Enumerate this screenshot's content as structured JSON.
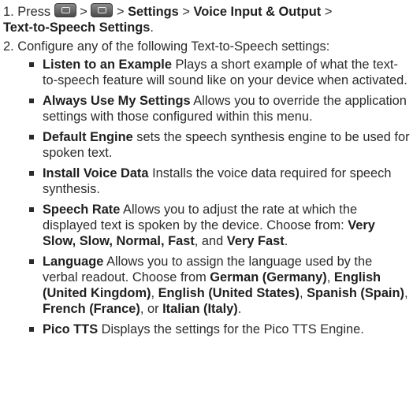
{
  "step1": {
    "number": "1.",
    "press": "Press",
    "sep": ">",
    "key1_icon": "menu-key-icon",
    "key2_icon": "menu-key-icon",
    "path1": "Settings",
    "path2": "Voice Input & Output",
    "path3": "Text-to-Speech Settings",
    "end": "."
  },
  "step2": {
    "number": "2.",
    "text": "Configure any of the following Text-to-Speech settings:"
  },
  "items": [
    {
      "title": "Listen to an Example",
      "desc": " Plays a short example of what the text-to-speech feature will sound like on your device when activated."
    },
    {
      "title": "Always Use My Settings",
      "desc": " Allows you to override the application settings with those configured within this menu."
    },
    {
      "title": "Default Engine",
      "desc": " sets the speech synthesis engine to be used for spoken text."
    },
    {
      "title": "Install Voice Data",
      "desc": " Installs the voice data required for speech synthesis."
    },
    {
      "title": "Speech Rate",
      "desc": " Allows you to adjust the rate at which the displayed text is spoken by the device. Choose from: ",
      "opts": [
        "Very Slow, Slow, Normal, Fast",
        ", and ",
        "Very Fast",
        "."
      ]
    },
    {
      "title": "Language",
      "desc": " Allows you to assign the language used by the verbal readout. Choose from ",
      "opts": [
        "German (Germany)",
        ", ",
        "English (United Kingdom)",
        ", ",
        "English (United States)",
        ", ",
        "Spanish (Spain)",
        ", ",
        "French (France)",
        ", or ",
        "Italian (Italy)",
        "."
      ]
    },
    {
      "title": "Pico TTS",
      "desc": " Displays the settings for the Pico TTS Engine."
    }
  ]
}
